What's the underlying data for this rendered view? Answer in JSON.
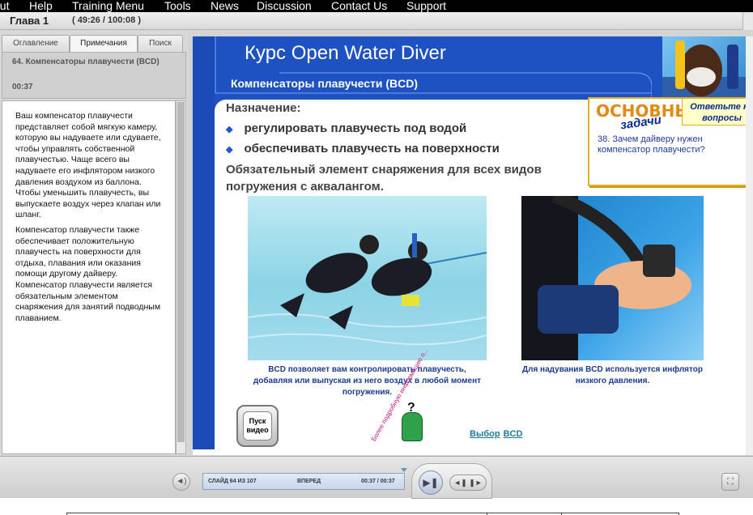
{
  "menu": {
    "items": [
      "out",
      "Help",
      "Training Menu",
      "Tools",
      "News",
      "Discussion",
      "Contact Us",
      "Support"
    ]
  },
  "header": {
    "chapter": "Глава 1",
    "timecode": "( 49:26 / 100:08 )"
  },
  "sidebar": {
    "tabs": [
      "Оглавление",
      "Примечания",
      "Поиск"
    ],
    "active_tab": "Примечания",
    "slide_title": "64. Компенсаторы плавучести (BCD)",
    "slide_time": "00:37",
    "notes": [
      "Ваш компенсатор плавучести представляет собой мягкую камеру, которую вы надуваете или сдуваете, чтобы управлять собственной плавучестью. Чаще всего вы надуваете его инфлятором низкого давления воздухом из баллона. Чтобы уменьшить плавучесть, вы выпускаете воздух через клапан или шланг.",
      "Компенсатор плавучести также обеспечивает положительную плавучесть на поверхности для отдыха, плавания или оказания помощи другому дайверу. Компенсатор плавучести является обязательным элементом снаряжения для занятий подводным плаванием."
    ]
  },
  "slide": {
    "course_title": "Курс Open Water Diver",
    "subtitle": "Компенсаторы плавучести (BCD)",
    "purpose_label": "Назначение:",
    "bullets": [
      "регулировать плавучесть под водой",
      "обеспечивать плавучесть на поверхности"
    ],
    "required_text": "Обязательный элемент снаряжения для всех видов погружения с аквалангом.",
    "key_box": {
      "title": "ОСНОВНЫЕ",
      "subtitle": "задачи",
      "answer_label": "Ответьте на вопросы",
      "question": "38. Зачем дайверу нужен компенсатор плавучести?"
    },
    "caption_left": "BCD позволяет вам контролировать плавучесть, добавляя или выпуская из него воздух в любой момент погружения.",
    "caption_right": "Для надувания BCD используется инфлятор низкого давления.",
    "play_video_label": "Пуск видео",
    "more_info_label": "Более подробную информацию о...",
    "link_word_1": "Выбор",
    "link_word_2": "BCD"
  },
  "controls": {
    "slide_counter": "СЛАЙД 64 ИЗ 107",
    "status": "ВПЕРЕД",
    "time": "00:37 / 00:37"
  },
  "colors": {
    "slide_blue": "#1e52c2",
    "key_box_border": "#e0b020",
    "caption_text": "#1a3c8f",
    "link": "#1f7a9a"
  }
}
